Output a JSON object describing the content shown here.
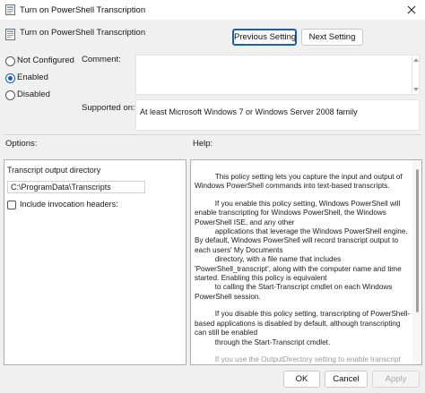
{
  "window": {
    "title": "Turn on PowerShell Transcription",
    "icon": "policy-settings-icon"
  },
  "header": {
    "policy_name": "Turn on PowerShell Transcription",
    "previous_setting": "Previous Setting",
    "next_setting": "Next Setting"
  },
  "state": {
    "options": [
      {
        "label": "Not Configured",
        "checked": false
      },
      {
        "label": "Enabled",
        "checked": true
      },
      {
        "label": "Disabled",
        "checked": false
      }
    ]
  },
  "comment": {
    "label": "Comment:",
    "value": ""
  },
  "supported": {
    "label": "Supported on:",
    "value": "At least Microsoft Windows 7 or Windows Server 2008 family"
  },
  "sections": {
    "options_label": "Options:",
    "help_label": "Help:"
  },
  "options_panel": {
    "directory_label": "Transcript output directory",
    "directory_value": "C:\\ProgramData\\Transcripts",
    "include_headers_label": "Include invocation headers:",
    "include_headers_checked": false
  },
  "help": {
    "paragraphs": [
      "          This policy setting lets you capture the input and output of Windows PowerShell commands into text-based transcripts.",
      "          If you enable this policy setting, Windows PowerShell will enable transcripting for Windows PowerShell, the Windows PowerShell ISE, and any other\n          applications that leverage the Windows PowerShell engine. By default, Windows PowerShell will record transcript output to each users' My Documents\n          directory, with a file name that includes 'PowerShell_transcript', along with the computer name and time started. Enabling this policy is equivalent\n          to calling the Start-Transcript cmdlet on each Windows PowerShell session.",
      "          If you disable this policy setting, transcripting of PowerShell-based applications is disabled by default, although transcripting can still be enabled\n          through the Start-Transcript cmdlet.",
      "          If you use the OutputDirectory setting to enable transcript logging"
    ]
  },
  "buttons": {
    "ok": "OK",
    "cancel": "Cancel",
    "apply": "Apply"
  },
  "colors": {
    "accent": "#1b5fb3",
    "background": "#f0f0f0"
  }
}
